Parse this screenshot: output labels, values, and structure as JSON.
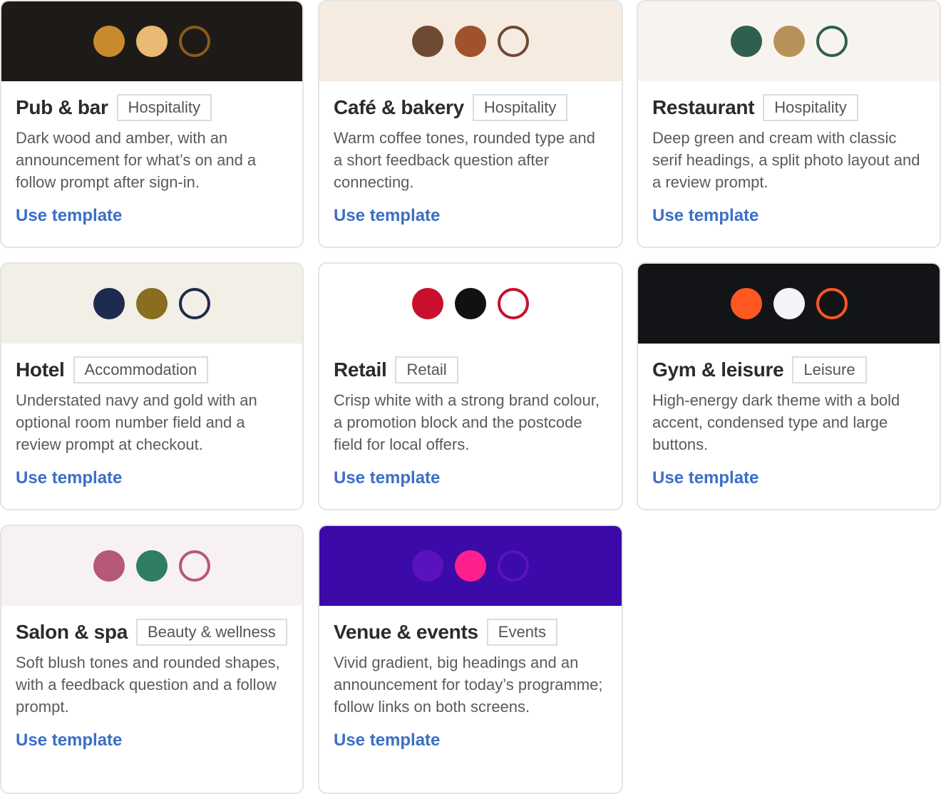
{
  "templates": [
    {
      "title": "Pub & bar",
      "tag": "Hospitality",
      "description": "Dark wood and amber, with an announcement for what’s on and a follow prompt after sign-in.",
      "link_label": "Use template",
      "header_bg": "#1e1a17",
      "swatches": [
        "#c98a2e",
        "#eab974",
        "#8a5a1e"
      ]
    },
    {
      "title": "Café & bakery",
      "tag": "Hospitality",
      "description": "Warm coffee tones, rounded type and a short feedback question after connecting.",
      "link_label": "Use template",
      "header_bg": "#f6ebe0",
      "swatches": [
        "#6e4a35",
        "#a0522d",
        "#6e4a35"
      ]
    },
    {
      "title": "Restaurant",
      "tag": "Hospitality",
      "description": "Deep green and cream with classic serif headings, a split photo layout and a review prompt.",
      "link_label": "Use template",
      "header_bg": "#f7f4ef",
      "swatches": [
        "#2f5f4f",
        "#b89158",
        "#2f5f4f"
      ]
    },
    {
      "title": "Hotel",
      "tag": "Accommodation",
      "description": "Understated navy and gold with an optional room number field and a review prompt at checkout.",
      "link_label": "Use template",
      "header_bg": "#f2efe7",
      "swatches": [
        "#1d2b4f",
        "#8a6d1e",
        "#1d2b4f"
      ]
    },
    {
      "title": "Retail",
      "tag": "Retail",
      "description": "Crisp white with a strong brand colour, a promotion block and the postcode field for local offers.",
      "link_label": "Use template",
      "header_bg": "#ffffff",
      "swatches": [
        "#c8102e",
        "#111111",
        "#c8102e"
      ]
    },
    {
      "title": "Gym & leisure",
      "tag": "Leisure",
      "description": "High-energy dark theme with a bold accent, condensed type and large buttons.",
      "link_label": "Use template",
      "header_bg": "#121418",
      "swatches": [
        "#ff5722",
        "#f3f4f6",
        "#ff5722"
      ]
    },
    {
      "title": "Salon & spa",
      "tag": "Beauty & wellness",
      "description": "Soft blush tones and rounded shapes, with a feedback question and a follow prompt.",
      "link_label": "Use template",
      "header_bg": "#f8f1f2",
      "swatches": [
        "#b5587a",
        "#2f7d62",
        "#b5587a"
      ]
    },
    {
      "title": "Venue & events",
      "tag": "Events",
      "description": "Vivid gradient, big headings and an announcement for today’s programme; follow links on both screens.",
      "link_label": "Use template",
      "header_bg": "#3b0aa8",
      "swatches": [
        "#5a12bf",
        "#ff1f8e",
        "#5a12bf"
      ]
    }
  ]
}
